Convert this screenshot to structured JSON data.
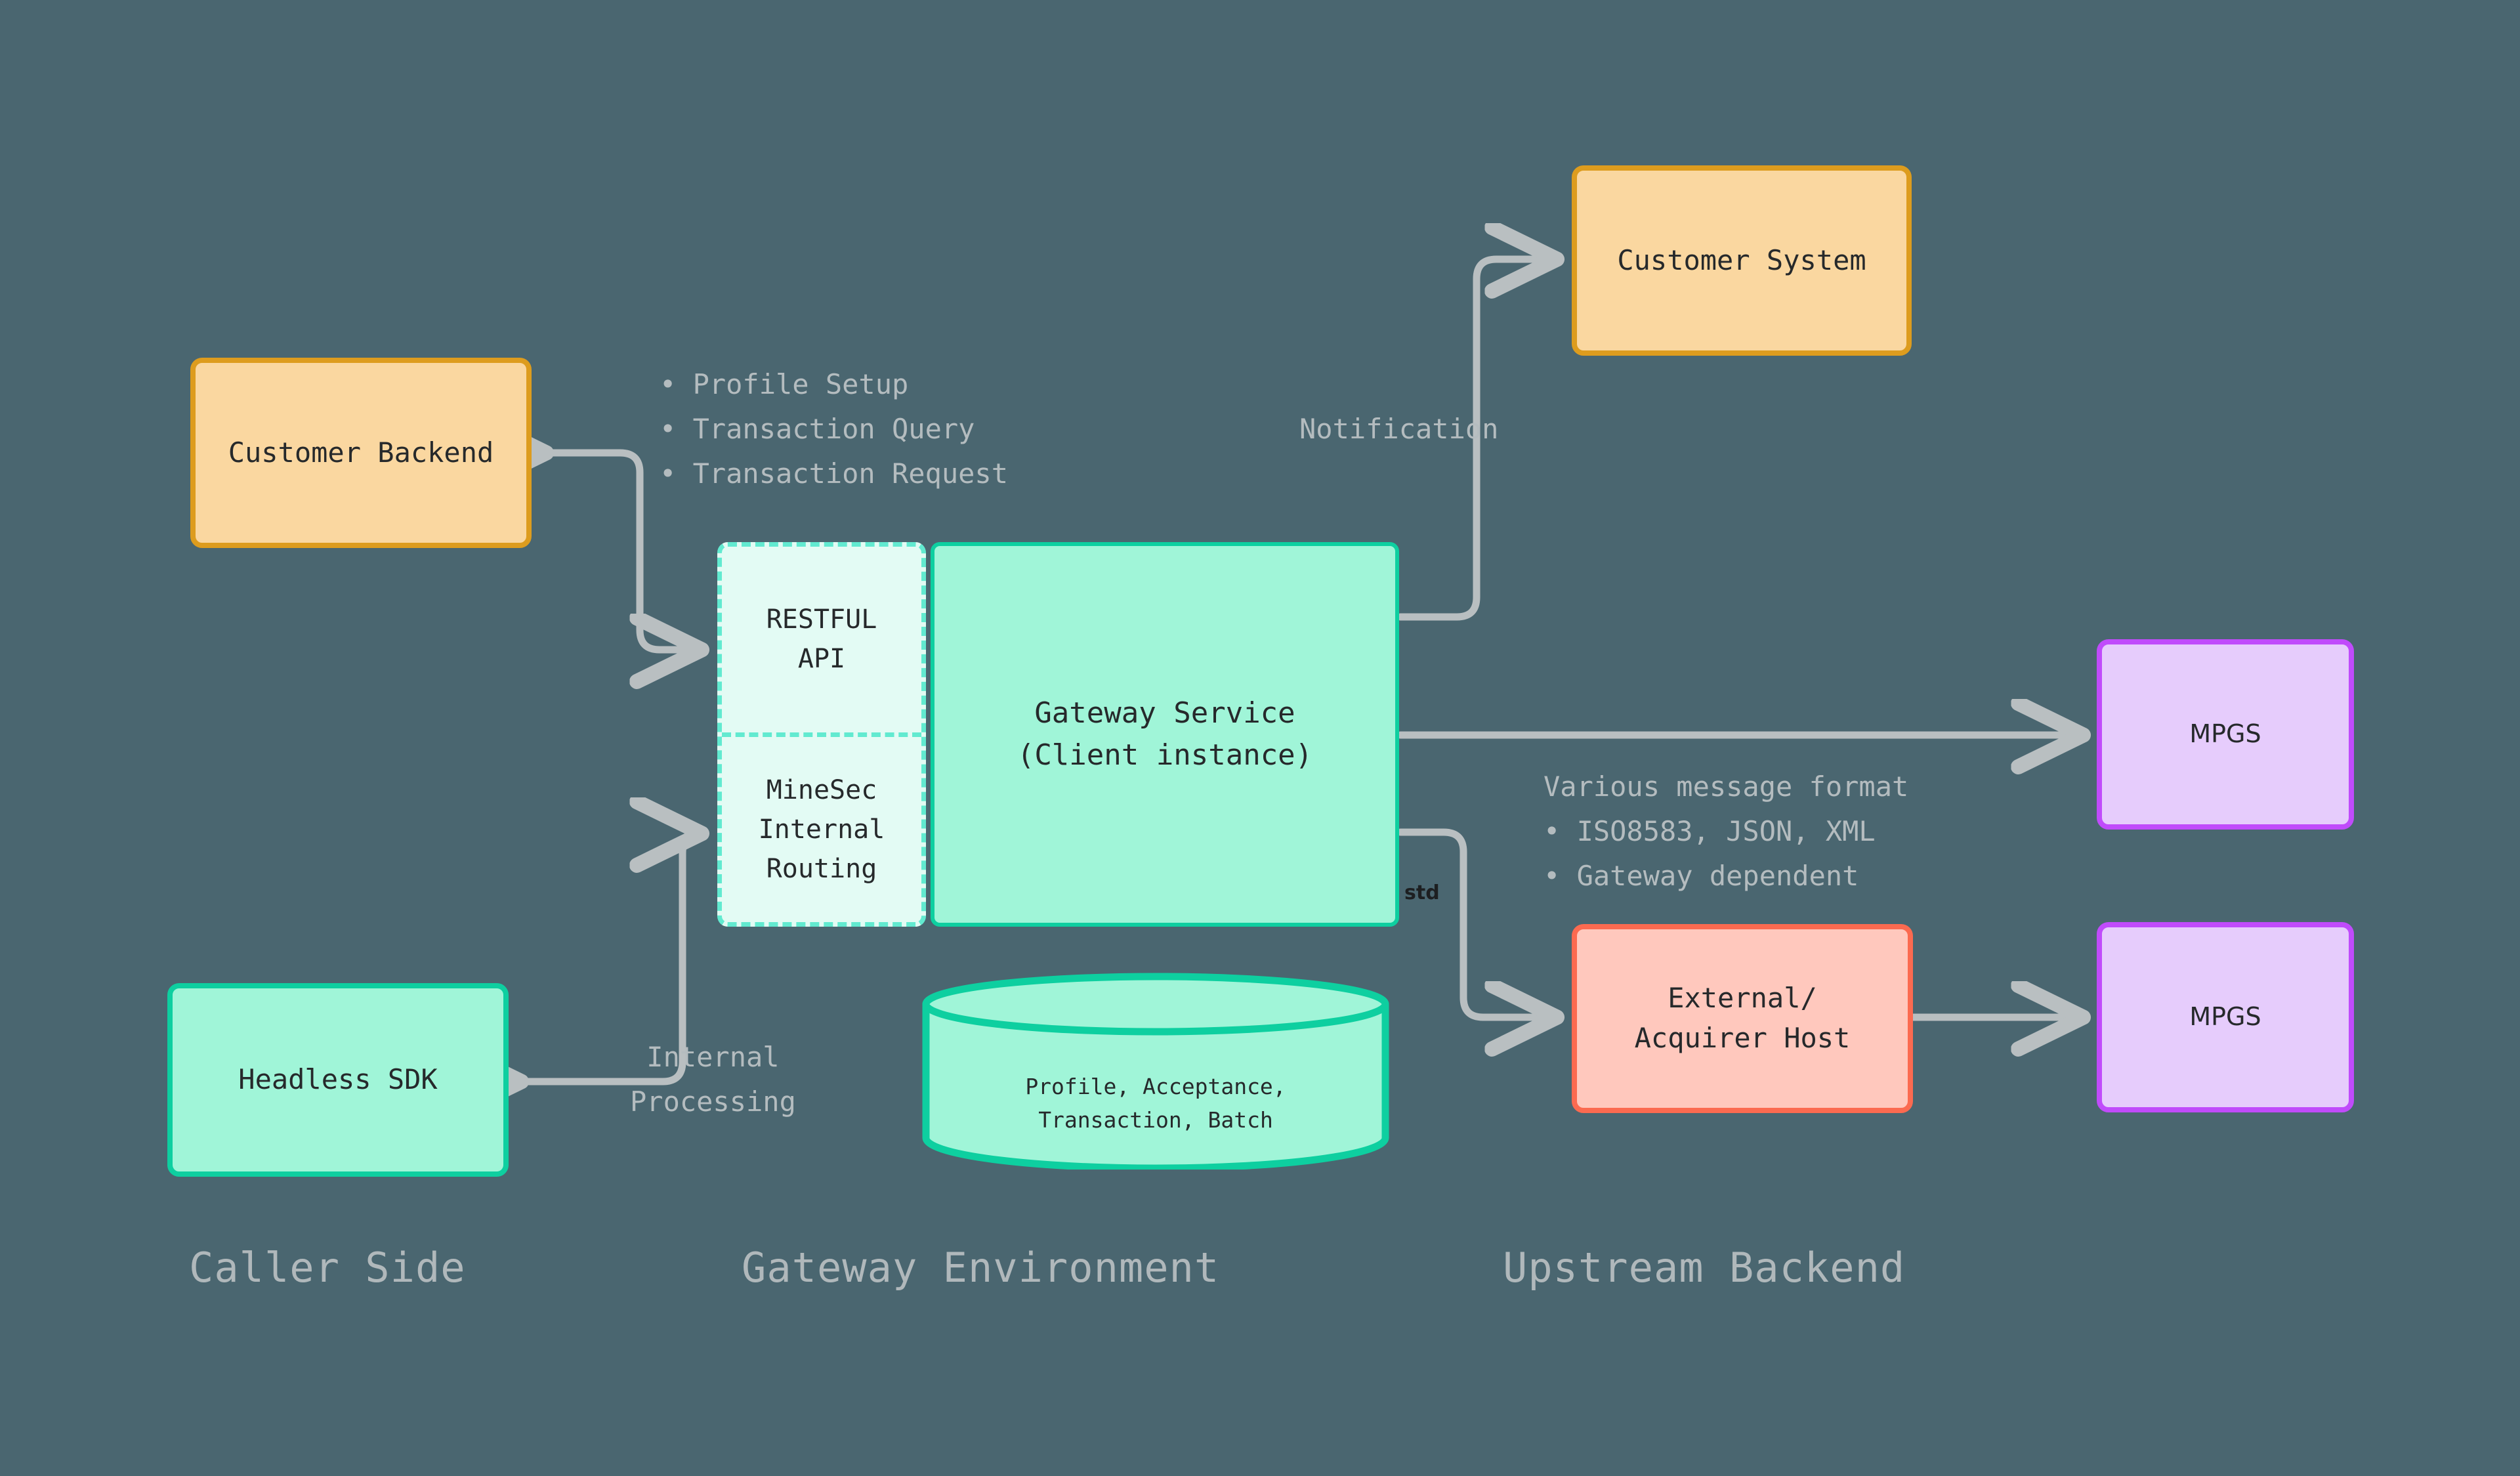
{
  "diagram": {
    "background_color": "#4a6670",
    "arrow_color": "#b9bfc1",
    "note_color": "#b4bcbf",
    "nodes": {
      "customer_backend": {
        "label": "Customer Backend",
        "fill": "#fad7a0",
        "stroke": "#dd9c1e"
      },
      "customer_system": {
        "label": "Customer System",
        "fill": "#fad7a0",
        "stroke": "#dd9c1e"
      },
      "headless_sdk": {
        "label": "Headless SDK",
        "fill": "#a0f5d8",
        "stroke": "#0ecfa0"
      },
      "restful_api": {
        "label": "RESTFUL\nAPI",
        "fill": "#e3fbf4",
        "stroke": "#62ead0"
      },
      "internal_routing": {
        "label": "MineSec\nInternal\nRouting",
        "fill": "#e3fbf4",
        "stroke": "#62ead0"
      },
      "gateway_service": {
        "label": "Gateway Service\n(Client instance)",
        "fill": "#a0f5d8",
        "stroke": "#0ecfa0"
      },
      "datastore": {
        "label": "Profile, Acceptance,\nTransaction, Batch",
        "fill": "#a0f5d8",
        "stroke": "#0ecfa0"
      },
      "acquirer_host": {
        "label": "External/\nAcquirer Host",
        "fill": "#ffc8bd",
        "stroke": "#fb6a50"
      },
      "mpgs_top": {
        "label": "MPGS",
        "fill": "#e6ccfc",
        "stroke": "#c04bfb"
      },
      "mpgs_bottom": {
        "label": "MPGS",
        "fill": "#e6ccfc",
        "stroke": "#c04bfb"
      }
    },
    "edge_labels": {
      "caller_capabilities": "• Profile Setup\n• Transaction Query\n• Transaction Request",
      "notification": "Notification",
      "internal_processing": "Internal\nProcessing",
      "message_format": "Various message format\n• ISO8583, JSON, XML\n• Gateway dependent",
      "std": "std"
    },
    "section_titles": {
      "caller": "Caller Side",
      "gateway": "Gateway Environment",
      "upstream": "Upstream Backend"
    }
  }
}
